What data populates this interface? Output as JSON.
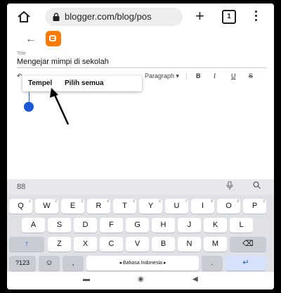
{
  "browser": {
    "url": "blogger.com/blog/pos",
    "tabs_count": "1"
  },
  "editor": {
    "title_label": "Title",
    "title_value": "Mengejar mimpi di sekolah",
    "toolbar": {
      "paragraph": "Paragraph",
      "paragraph_caret": "▾",
      "bold": "B",
      "italic": "I",
      "underline": "U",
      "strike": "S"
    }
  },
  "context_menu": {
    "paste": "Tempel",
    "select_all": "Pilih semua"
  },
  "keyboard": {
    "row1": [
      "Q",
      "W",
      "E",
      "R",
      "T",
      "Y",
      "U",
      "I",
      "O",
      "P"
    ],
    "row1_sup": [
      "1",
      "2",
      "3",
      "4",
      "5",
      "6",
      "7",
      "8",
      "9",
      "0"
    ],
    "row2": [
      "A",
      "S",
      "D",
      "F",
      "G",
      "H",
      "J",
      "K",
      "L"
    ],
    "row3": [
      "Z",
      "X",
      "C",
      "V",
      "B",
      "N",
      "M"
    ],
    "symbols_key": "?123",
    "comma": ",",
    "space_label": "◂ Bahasa Indonesia ▸",
    "period": ".",
    "shift_icon": "↑",
    "backspace_icon": "⌫",
    "enter_icon": "↵",
    "emoji_icon": "☺",
    "grid_icon": "88",
    "mic_icon": "🎤",
    "search_icon": "🔍"
  },
  "nav": {
    "recent_icon": "▬",
    "home_icon": "◉",
    "back_icon": "◀"
  }
}
